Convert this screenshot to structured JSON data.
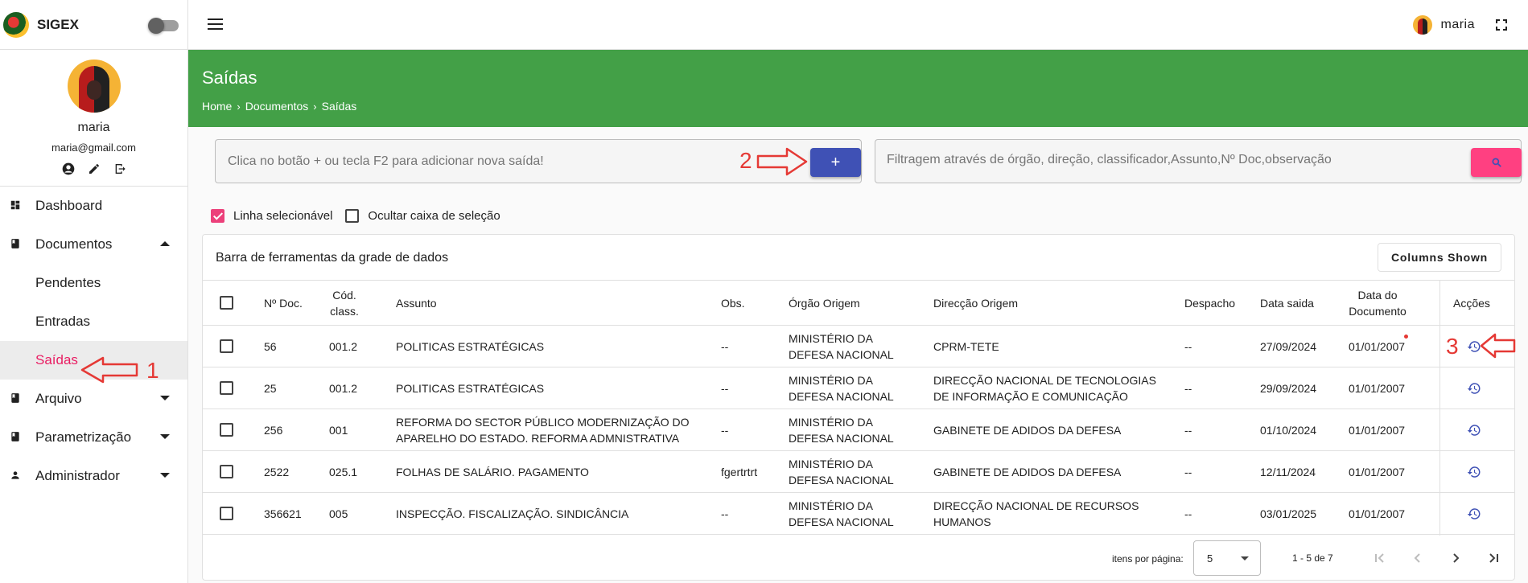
{
  "app": {
    "name": "SIGEX"
  },
  "profile": {
    "name": "maria",
    "email": "maria@gmail.com"
  },
  "topbar": {
    "user_name": "maria"
  },
  "nav": {
    "dashboard": "Dashboard",
    "documentos": "Documentos",
    "pendentes": "Pendentes",
    "entradas": "Entradas",
    "saidas": "Saídas",
    "arquivo": "Arquivo",
    "parametrizacao": "Parametrização",
    "administrador": "Administrador"
  },
  "header": {
    "title": "Saídas",
    "breadcrumb": [
      "Home",
      "Documentos",
      "Saídas"
    ]
  },
  "add_box": {
    "placeholder": "Clica no botão + ou tecla F2 para adicionar nova saída!",
    "button": "+"
  },
  "filter": {
    "placeholder": "Filtragem através de órgão, direção, classificador,Assunto,Nº Doc,observação"
  },
  "options": {
    "selectable_row": "Linha selecionável",
    "hide_checkbox": "Ocultar caixa de seleção"
  },
  "grid": {
    "toolbar_title": "Barra de ferramentas da grade de dados",
    "columns_button": "Columns Shown",
    "headers": {
      "num": "Nº Doc.",
      "cod": "Cód. class.",
      "assunto": "Assunto",
      "obs": "Obs.",
      "orgao": "Órgão Origem",
      "direccao": "Direcção Origem",
      "despacho": "Despacho",
      "data_saida": "Data saida",
      "data_doc": "Data do Documento",
      "accoes": "Acções"
    },
    "rows": [
      {
        "num": "56",
        "cod": "001.2",
        "assunto": "POLITICAS ESTRATÉGICAS",
        "obs": "--",
        "orgao": "MINISTÉRIO DA DEFESA NACIONAL",
        "direccao": "CPRM-TETE",
        "despacho": "--",
        "data_saida": "27/09/2024",
        "data_doc": "01/01/2007"
      },
      {
        "num": "25",
        "cod": "001.2",
        "assunto": "POLITICAS ESTRATÉGICAS",
        "obs": "--",
        "orgao": "MINISTÉRIO DA DEFESA NACIONAL",
        "direccao": "DIRECÇÃO NACIONAL DE TECNOLOGIAS DE INFORMAÇÃO E COMUNICAÇÃO",
        "despacho": "--",
        "data_saida": "29/09/2024",
        "data_doc": "01/01/2007"
      },
      {
        "num": "256",
        "cod": "001",
        "assunto": "REFORMA DO SECTOR PÚBLICO MODERNIZAÇÃO DO APARELHO DO ESTADO. REFORMA ADMNISTRATIVA",
        "obs": "--",
        "orgao": "MINISTÉRIO DA DEFESA NACIONAL",
        "direccao": "GABINETE DE ADIDOS DA DEFESA",
        "despacho": "--",
        "data_saida": "01/10/2024",
        "data_doc": "01/01/2007"
      },
      {
        "num": "2522",
        "cod": "025.1",
        "assunto": "FOLHAS DE SALÁRIO. PAGAMENTO",
        "obs": "fgertrtrt",
        "orgao": "MINISTÉRIO DA DEFESA NACIONAL",
        "direccao": "GABINETE DE ADIDOS DA DEFESA",
        "despacho": "--",
        "data_saida": "12/11/2024",
        "data_doc": "01/01/2007"
      },
      {
        "num": "356621",
        "cod": "005",
        "assunto": "INSPECÇÃO. FISCALIZAÇÃO. SINDICÂNCIA",
        "obs": "--",
        "orgao": "MINISTÉRIO DA DEFESA NACIONAL",
        "direccao": "DIRECÇÃO NACIONAL DE RECURSOS HUMANOS",
        "despacho": "--",
        "data_saida": "03/01/2025",
        "data_doc": "01/01/2007"
      }
    ],
    "footer": {
      "per_page_label": "itens por página:",
      "per_page_value": "5",
      "range": "1 - 5 de 7"
    }
  },
  "annotations": {
    "one": "1",
    "two": "2",
    "three": "3",
    "color": "#e53935"
  },
  "colors": {
    "header_green": "#43a047",
    "add_button": "#3f51b5",
    "search_button": "#ff4081",
    "active_nav": "#e91e63"
  }
}
